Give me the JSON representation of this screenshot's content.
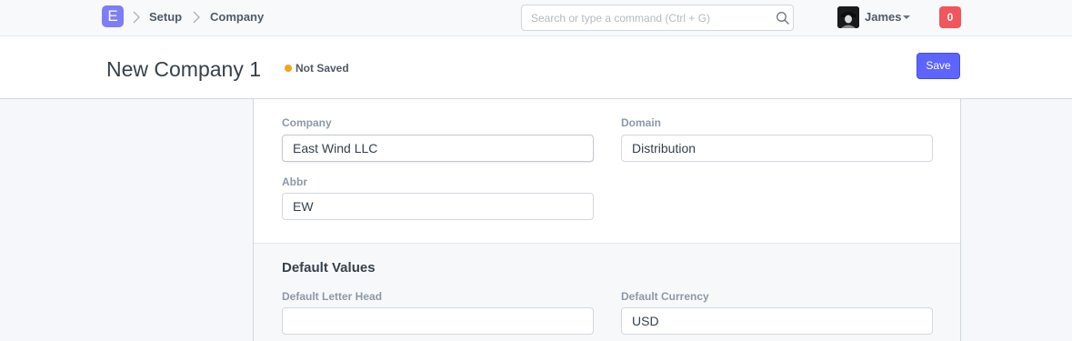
{
  "navbar": {
    "logo_letter": "E",
    "breadcrumbs": [
      "Setup",
      "Company"
    ],
    "search_placeholder": "Search or type a command (Ctrl + G)",
    "user_name": "James",
    "notification_count": "0"
  },
  "page_head": {
    "title": "New Company 1",
    "status": "Not Saved",
    "save_label": "Save"
  },
  "form": {
    "company_label": "Company",
    "company_value": "East Wind LLC",
    "domain_label": "Domain",
    "domain_value": "Distribution",
    "abbr_label": "Abbr",
    "abbr_value": "EW",
    "default_values_title": "Default Values",
    "letter_head_label": "Default Letter Head",
    "letter_head_value": "",
    "currency_label": "Default Currency",
    "currency_value": "USD"
  },
  "colors": {
    "logo": "#7d7ef7",
    "primary": "#5e64ff",
    "status_dot": "#f0a51a",
    "notification": "#f0565b"
  }
}
